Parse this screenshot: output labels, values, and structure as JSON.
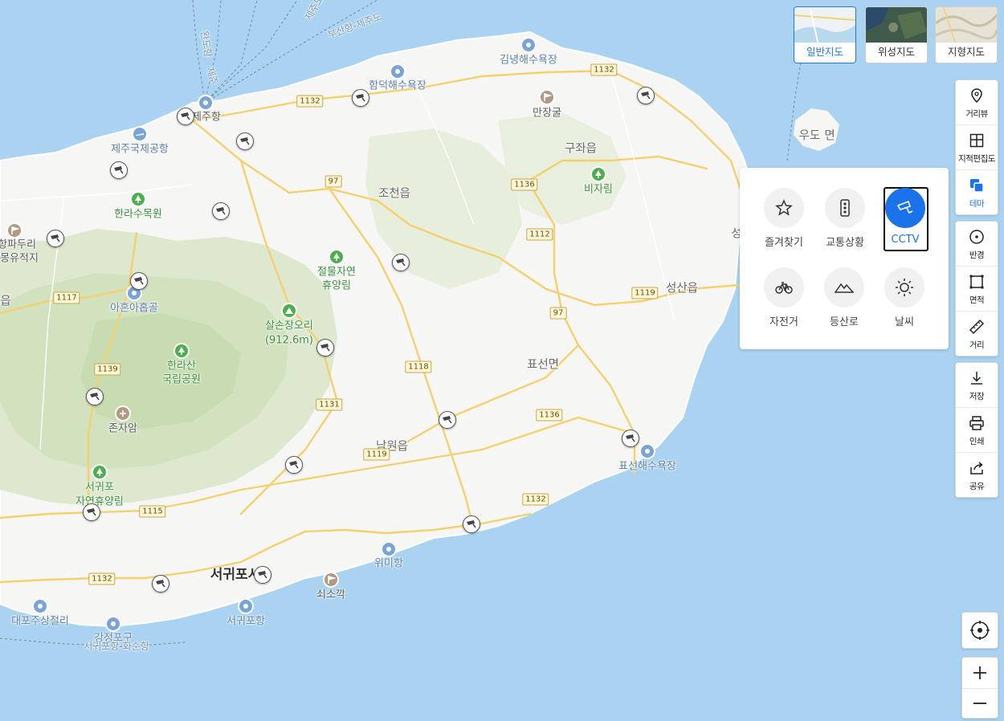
{
  "map_type": {
    "selected": "일반지도",
    "options": [
      "일반지도",
      "위성지도",
      "지형지도"
    ]
  },
  "toolbar": {
    "group1": [
      "거리뷰",
      "지적편집도",
      "테마"
    ],
    "group2": [
      "반경",
      "면적",
      "거리"
    ],
    "group3": [
      "저장",
      "인쇄",
      "공유"
    ],
    "selected": "테마"
  },
  "theme_panel": {
    "items": [
      "즐겨찾기",
      "교통상황",
      "CCTV",
      "자전거",
      "등산로",
      "날씨"
    ],
    "selected": "CCTV"
  },
  "map": {
    "towns": [
      "조천읍",
      "구좌읍",
      "성산읍",
      "표선면",
      "남원읍"
    ],
    "city": "서귀포시",
    "place_labels": {
      "jeju_port": "제주항",
      "airport": "제주국제공항",
      "arboretum": "한라수목원",
      "hangpadu1": "항파두리",
      "hangpadu2": "몽유적지",
      "aeup": "읍",
      "aheun": "아흔아홉골",
      "halla1": "한라산",
      "halla2": "국립공원",
      "jonjaam": "존자암",
      "seogwipo_forest1": "서귀포",
      "seogwipo_forest2": "자연휴양림",
      "jeolmul1": "절물자연",
      "jeolmul2": "휴양림",
      "salson1": "살손장오리",
      "salson2": "(912.6m)",
      "hamdeok": "함덕해수욕장",
      "gimnyeong": "김녕해수욕장",
      "manjang": "만장굴",
      "bijarim": "비자림",
      "udo": "우도",
      "udo_suffix": "면",
      "seongsan_edge": "성",
      "pyoseon_beach": "표선해수욕장",
      "wimi": "위미항",
      "soesokkak": "쇠소깍",
      "seogwipo_port": "서귀포항",
      "daepo": "대포주상절리",
      "gangjeong": "강정포구",
      "ferry_jeju": "부산항-제주도",
      "ferry_wando": "완도항",
      "ferry_wando2": "제주",
      "ferry_route_bottom": "서귀포항-화순항",
      "ferry_top": "제주도"
    },
    "routes": [
      "1132",
      "97",
      "1136",
      "1112",
      "1119",
      "1118",
      "1131",
      "1139",
      "1117",
      "1115",
      "1132",
      "97",
      "1136",
      "1119",
      "1132"
    ]
  },
  "colors": {
    "accent": "#1f7ae0",
    "sea": "#a9d3f0",
    "land": "#f6f6f4",
    "park": "#d8e6c7"
  }
}
